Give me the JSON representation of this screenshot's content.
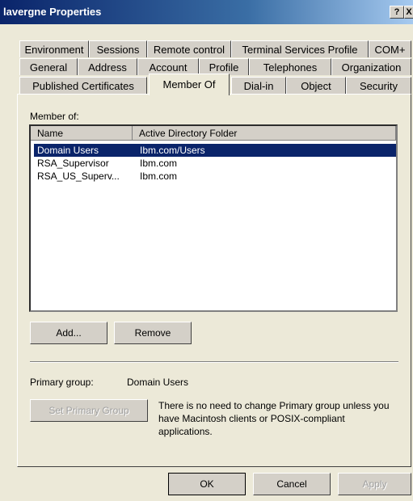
{
  "window": {
    "title": "lavergne Properties",
    "help_label": "?",
    "close_label": "X"
  },
  "tabs": {
    "row1": [
      "Environment",
      "Sessions",
      "Remote control",
      "Terminal Services Profile",
      "COM+"
    ],
    "row2": [
      "General",
      "Address",
      "Account",
      "Profile",
      "Telephones",
      "Organization"
    ],
    "row3": [
      "Published Certificates",
      "Member Of",
      "Dial-in",
      "Object",
      "Security"
    ],
    "active": "Member Of"
  },
  "member_of": {
    "label": "Member of:",
    "columns": [
      "Name",
      "Active Directory Folder"
    ],
    "rows": [
      {
        "name": "Domain Users",
        "folder": "Ibm.com/Users",
        "selected": true
      },
      {
        "name": "RSA_Supervisor",
        "folder": "Ibm.com",
        "selected": false
      },
      {
        "name": "RSA_US_Superv...",
        "folder": "Ibm.com",
        "selected": false
      }
    ]
  },
  "buttons": {
    "add": "Add...",
    "remove": "Remove",
    "set_primary": "Set Primary Group",
    "ok": "OK",
    "cancel": "Cancel",
    "apply": "Apply"
  },
  "primary_group": {
    "label": "Primary group:",
    "value": "Domain Users",
    "note": "There is no need to change Primary group unless you have Macintosh clients or POSIX-compliant applications."
  },
  "colors": {
    "dialog_bg": "#ece9d8",
    "selection": "#0a246a",
    "titlebar": "#0a246a"
  }
}
